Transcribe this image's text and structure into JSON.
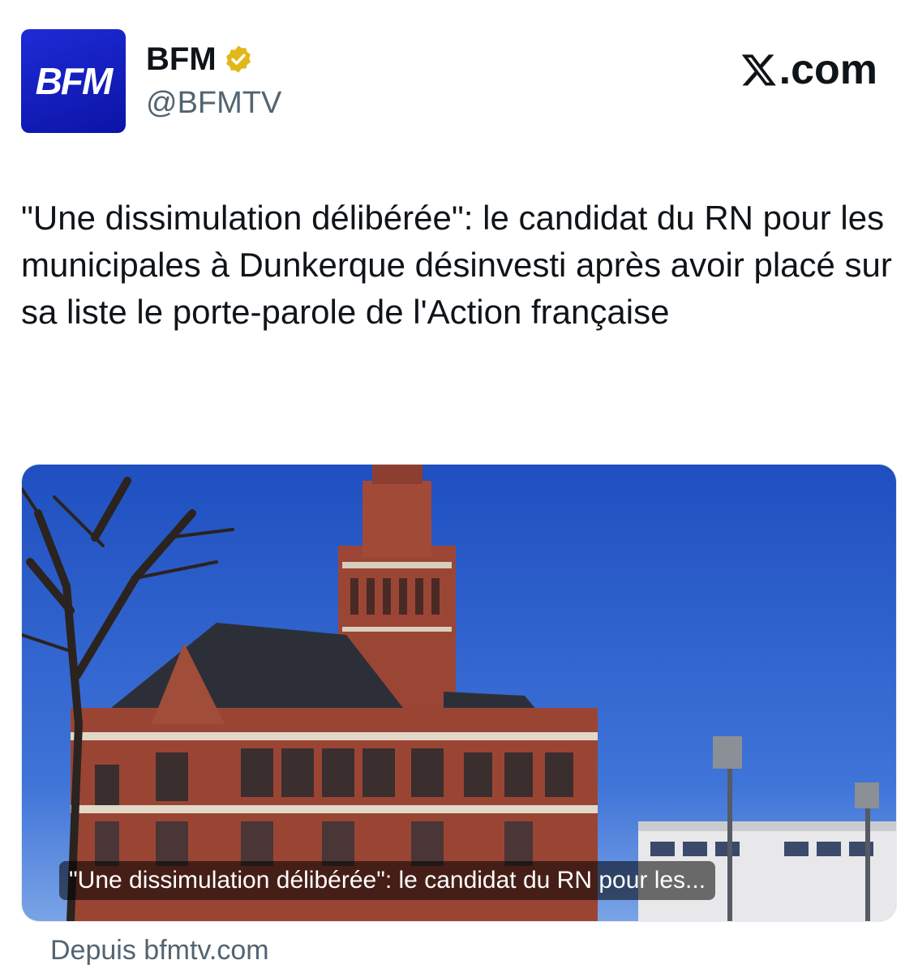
{
  "account": {
    "avatar_text": "BFM",
    "display_name": "BFM",
    "handle": "@BFMTV",
    "verified_badge": "verified-gold-badge-icon"
  },
  "site_label": ".com",
  "site_logo": "x-logo-icon",
  "tweet": {
    "text": "\"Une dissimulation délibérée\": le candidat du RN pour les municipales à Dunkerque désinvesti après avoir placé sur sa liste le porte-parole de l'Action française"
  },
  "card": {
    "image": "dunkerque-city-hall-photo",
    "caption": "\"Une dissimulation délibérée\": le candidat du RN pour les..."
  },
  "source_text": "Depuis bfmtv.com",
  "colors": {
    "brand_blue": "#1424c8",
    "badge_gold": "#e2b719",
    "secondary_text": "#536471"
  }
}
